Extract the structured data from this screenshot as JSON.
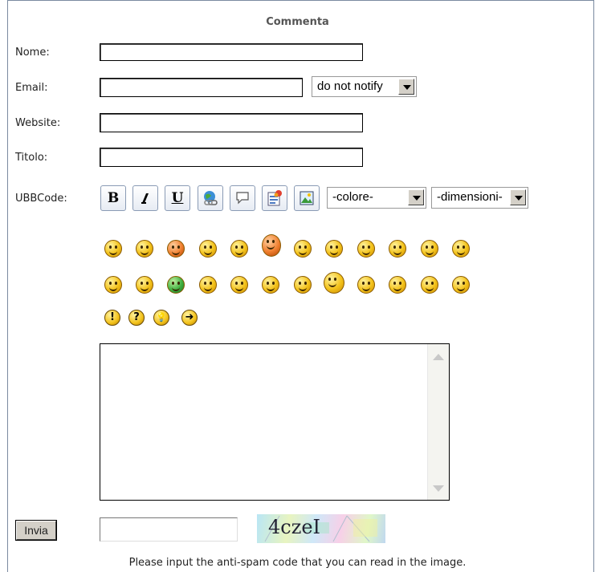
{
  "form": {
    "title": "Commenta",
    "fields": {
      "nome_label": "Nome:",
      "email_label": "Email:",
      "website_label": "Website:",
      "titolo_label": "Titolo:",
      "ubbcode_label": "UBBCode:"
    },
    "notify_select": {
      "selected": "do not notify"
    },
    "color_select": {
      "selected": "-colore-"
    },
    "size_select": {
      "selected": "-dimensioni-"
    },
    "ubb_buttons": [
      {
        "label": "B",
        "icon": "bold-icon"
      },
      {
        "label": "I",
        "icon": "italic-icon"
      },
      {
        "label": "U",
        "icon": "underline-icon"
      },
      {
        "label": "",
        "icon": "link-icon"
      },
      {
        "label": "",
        "icon": "quote-icon"
      },
      {
        "label": "",
        "icon": "code-icon"
      },
      {
        "label": "",
        "icon": "image-icon"
      }
    ],
    "symbols": [
      "!",
      "?",
      "💡",
      "➜"
    ],
    "submit_label": "Invia",
    "captcha_text": "4czeI",
    "antispam_note": "Please input the anti-spam code that you can read in the image."
  }
}
